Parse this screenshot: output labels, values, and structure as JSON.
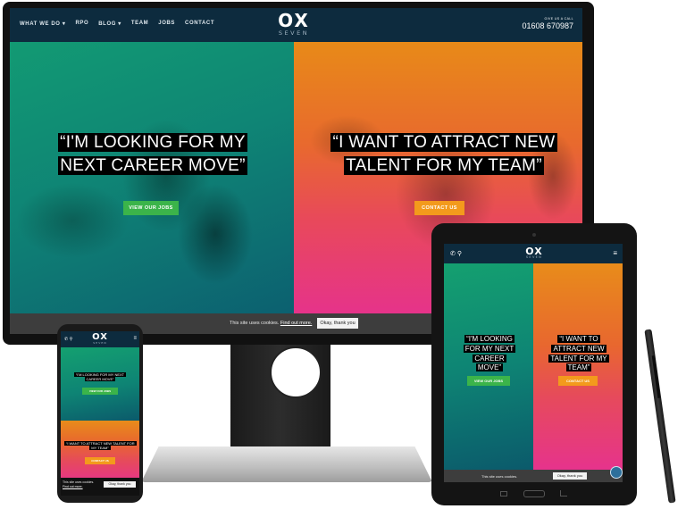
{
  "brand": {
    "logo_top": "OX",
    "logo_bottom": "SEVEN"
  },
  "nav": {
    "items": [
      {
        "label": "WHAT WE DO ▾"
      },
      {
        "label": "RPO"
      },
      {
        "label": "BLOG ▾"
      },
      {
        "label": "TEAM"
      },
      {
        "label": "JOBS"
      },
      {
        "label": "CONTACT"
      }
    ],
    "call_label": "GIVE US A CALL",
    "phone": "01608 670987"
  },
  "hero": {
    "left_quote": "“I'M LOOKING FOR MY NEXT CAREER MOVE”",
    "left_cta": "VIEW OUR JOBS",
    "right_quote": "“I WANT TO ATTRACT NEW TALENT FOR MY TEAM”",
    "right_cta": "CONTACT US"
  },
  "cookie": {
    "text": "This site uses cookies.",
    "link": "Find out more.",
    "button": "Okay, thank you"
  },
  "icons": {
    "phone": "phone-icon",
    "location": "map-pin-icon",
    "menu": "hamburger-menu-icon",
    "chat": "chat-bubble-icon"
  },
  "colors": {
    "navy": "#0d2b3e",
    "green_cta": "#3bb44a",
    "orange_cta": "#f39a1c",
    "teal_panel": "#0f8575",
    "magenta_panel": "#e6338a"
  }
}
